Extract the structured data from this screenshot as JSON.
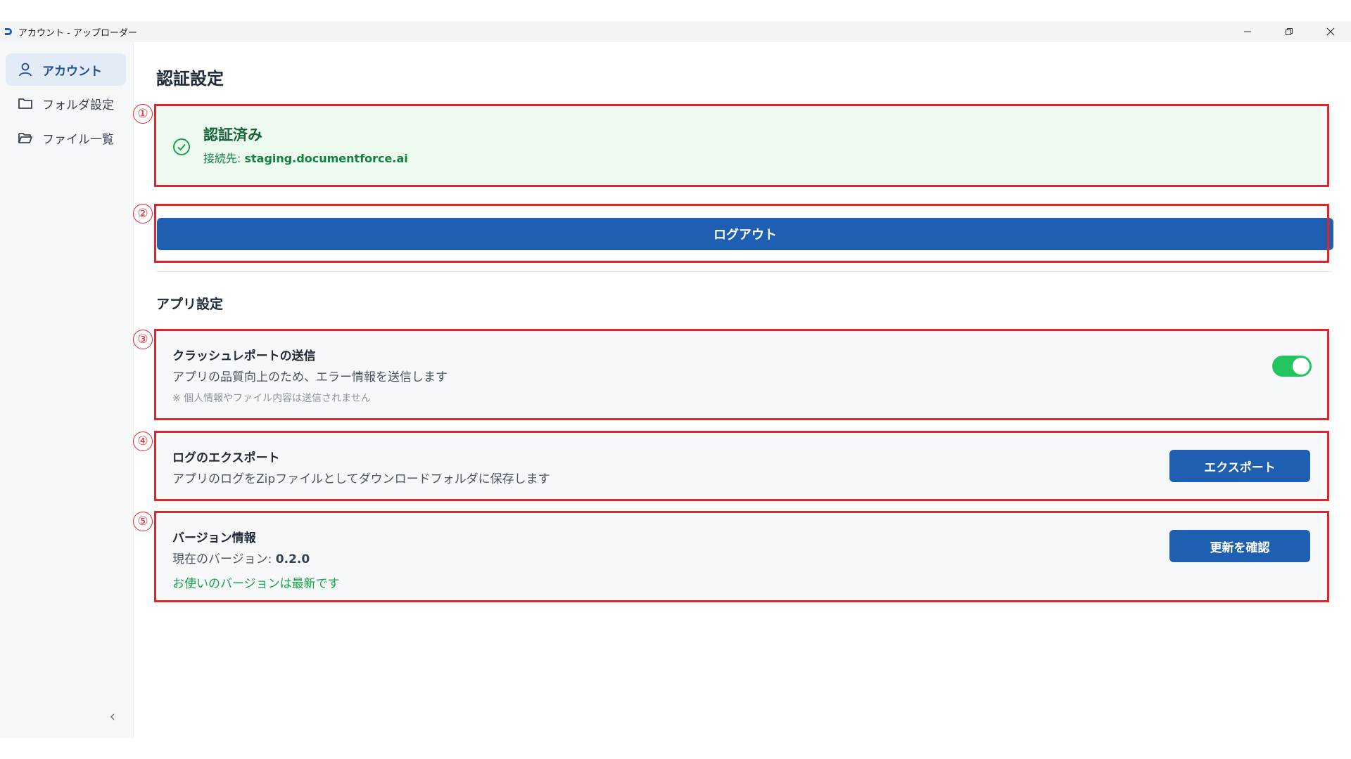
{
  "window": {
    "title": "アカウント - アップローダー"
  },
  "sidebar": {
    "items": [
      {
        "label": "アカウント",
        "icon": "user-icon",
        "active": true
      },
      {
        "label": "フォルダ設定",
        "icon": "folder-icon",
        "active": false
      },
      {
        "label": "ファイル一覧",
        "icon": "folder-open-icon",
        "active": false
      }
    ]
  },
  "auth_section": {
    "heading": "認証設定",
    "status_title": "認証済み",
    "connection_label": "接続先: ",
    "connection_host": "staging.documentforce.ai",
    "logout_label": "ログアウト"
  },
  "app_section": {
    "heading": "アプリ設定",
    "crash_report": {
      "title": "クラッシュレポートの送信",
      "description": "アプリの品質向上のため、エラー情報を送信します",
      "note": "※ 個人情報やファイル内容は送信されません",
      "enabled": true
    },
    "log_export": {
      "title": "ログのエクスポート",
      "description": "アプリのログをZipファイルとしてダウンロードフォルダに保存します",
      "button_label": "エクスポート"
    },
    "version": {
      "title": "バージョン情報",
      "current_label": "現在のバージョン: ",
      "current_version": "0.2.0",
      "status": "お使いのバージョンは最新です",
      "button_label": "更新を確認"
    }
  },
  "annotations": [
    "①",
    "②",
    "③",
    "④",
    "⑤"
  ],
  "colors": {
    "primary": "#1e5fb1",
    "success": "#16a34a",
    "annotation": "#e0262d",
    "toggle_on": "#22c55e"
  }
}
